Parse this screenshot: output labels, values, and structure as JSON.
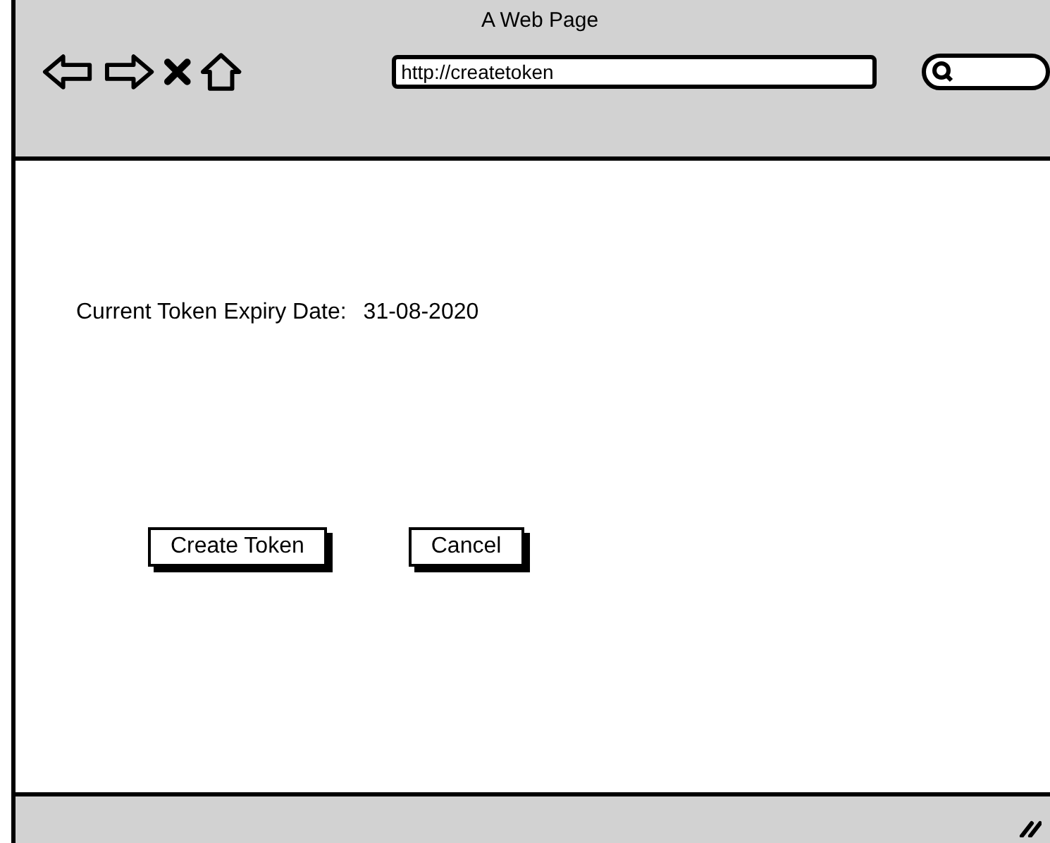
{
  "window": {
    "title": "A Web Page"
  },
  "address_bar": {
    "value": "http://createtoken"
  },
  "expiry": {
    "label": "Current Token Expiry Date:",
    "value": "31-08-2020"
  },
  "buttons": [
    "Create Token",
    "Cancel"
  ]
}
